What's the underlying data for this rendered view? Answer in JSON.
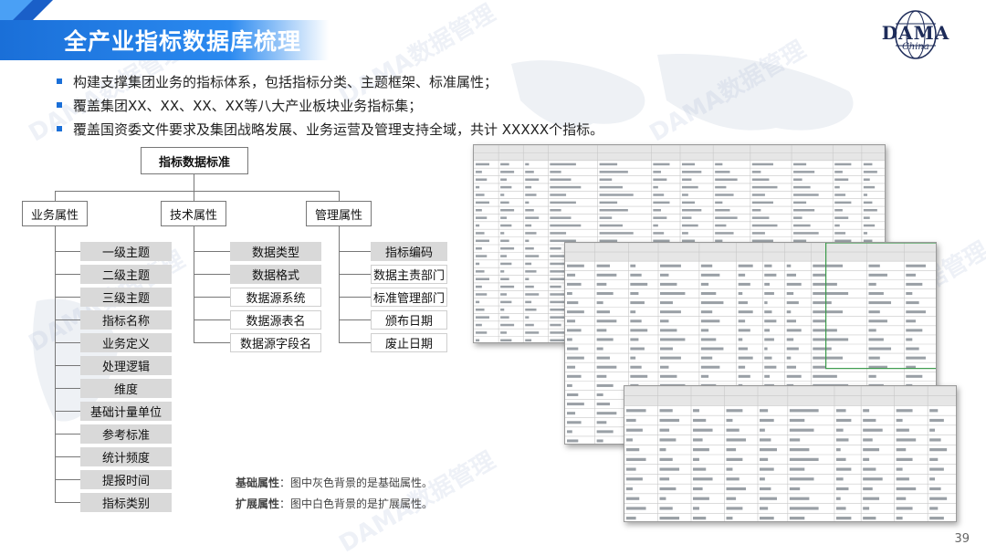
{
  "header": {
    "title": "全产业指标数据库梳理",
    "logo_text": "DAMA",
    "logo_sub": "China"
  },
  "bullets": [
    "构建支撑集团业务的指标体系，包括指标分类、主题框架、标准属性；",
    "覆盖集团XX、XX、XX、XX等八大产业板块业务指标集；",
    "覆盖国资委文件要求及集团战略发展、业务运营及管理支持全域，共计 XXXXX个指标。"
  ],
  "tree": {
    "root": "指标数据标准",
    "branches": [
      {
        "label": "业务属性",
        "items": [
          {
            "text": "一级主题",
            "basic": true
          },
          {
            "text": "二级主题",
            "basic": true
          },
          {
            "text": "三级主题",
            "basic": true
          },
          {
            "text": "指标名称",
            "basic": true
          },
          {
            "text": "业务定义",
            "basic": true
          },
          {
            "text": "处理逻辑",
            "basic": true
          },
          {
            "text": "维度",
            "basic": true
          },
          {
            "text": "基础计量单位",
            "basic": true
          },
          {
            "text": "参考标准",
            "basic": true
          },
          {
            "text": "统计频度",
            "basic": true
          },
          {
            "text": "提报时间",
            "basic": true
          },
          {
            "text": "指标类别",
            "basic": true
          }
        ]
      },
      {
        "label": "技术属性",
        "items": [
          {
            "text": "数据类型",
            "basic": true
          },
          {
            "text": "数据格式",
            "basic": true
          },
          {
            "text": "数据源系统",
            "basic": false
          },
          {
            "text": "数据源表名",
            "basic": false
          },
          {
            "text": "数据源字段名",
            "basic": false
          }
        ]
      },
      {
        "label": "管理属性",
        "items": [
          {
            "text": "指标编码",
            "basic": true
          },
          {
            "text": "数据主责部门",
            "basic": false
          },
          {
            "text": "标准管理部门",
            "basic": false
          },
          {
            "text": "颁布日期",
            "basic": false
          },
          {
            "text": "废止日期",
            "basic": false
          }
        ]
      }
    ]
  },
  "notes": {
    "basic_label": "基础属性",
    "basic_text": "：图中灰色背景的是基础属性。",
    "ext_label": "扩展属性",
    "ext_text": "：图中白色背景的是扩展属性。"
  },
  "watermark": "DAMA数据管理",
  "page_number": "39",
  "colors": {
    "brand_blue": "#1a6fd8",
    "basic_gray": "#d9d9d9",
    "header_text": "#ffffff"
  }
}
